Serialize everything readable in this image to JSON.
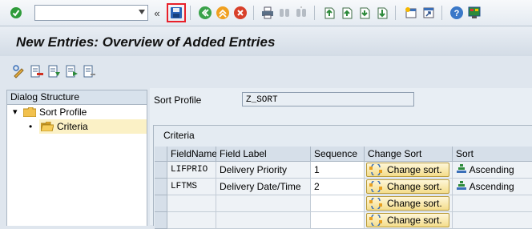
{
  "toolbar": {
    "command_value": "",
    "icons": [
      "enter-icon",
      "save-icon",
      "back-icon",
      "exit-icon",
      "cancel-icon",
      "print-icon",
      "find-icon",
      "find-next-icon",
      "first-page-icon",
      "previous-page-icon",
      "next-page-icon",
      "last-page-icon",
      "new-session-icon",
      "shortcut-icon",
      "help-icon",
      "layout-menu-icon"
    ]
  },
  "title": "New Entries: Overview of Added Entries",
  "app_toolbar": {
    "icons": [
      "change-display-icon",
      "delete-icon",
      "select-all-icon",
      "select-block-icon",
      "deselect-all-icon"
    ]
  },
  "dialog_structure": {
    "header": "Dialog Structure",
    "items": [
      {
        "label": "Sort Profile",
        "expander": "▾"
      },
      {
        "label": "Criteria",
        "bullet": "•"
      }
    ]
  },
  "sort_profile": {
    "label": "Sort Profile",
    "value": "Z_SORT"
  },
  "criteria": {
    "title": "Criteria",
    "columns": [
      "FieldName",
      "Field Label",
      "Sequence",
      "Change Sort",
      "Sort"
    ],
    "rows": [
      {
        "fieldname": "LIFPRIO",
        "field_label": "Delivery Priority",
        "sequence": "1",
        "change_sort": "Change sort.",
        "sort": "Ascending"
      },
      {
        "fieldname": "LFTMS",
        "field_label": "Delivery Date/Time",
        "sequence": "2",
        "change_sort": "Change sort.",
        "sort": "Ascending"
      },
      {
        "fieldname": "",
        "field_label": "",
        "sequence": "",
        "change_sort": "Change sort.",
        "sort": ""
      },
      {
        "fieldname": "",
        "field_label": "",
        "sequence": "",
        "change_sort": "Change sort.",
        "sort": ""
      }
    ]
  },
  "colors": {
    "save_highlight": "#e8202a",
    "folder": "#f2c14e",
    "selected_row": "#fbf1c6"
  }
}
